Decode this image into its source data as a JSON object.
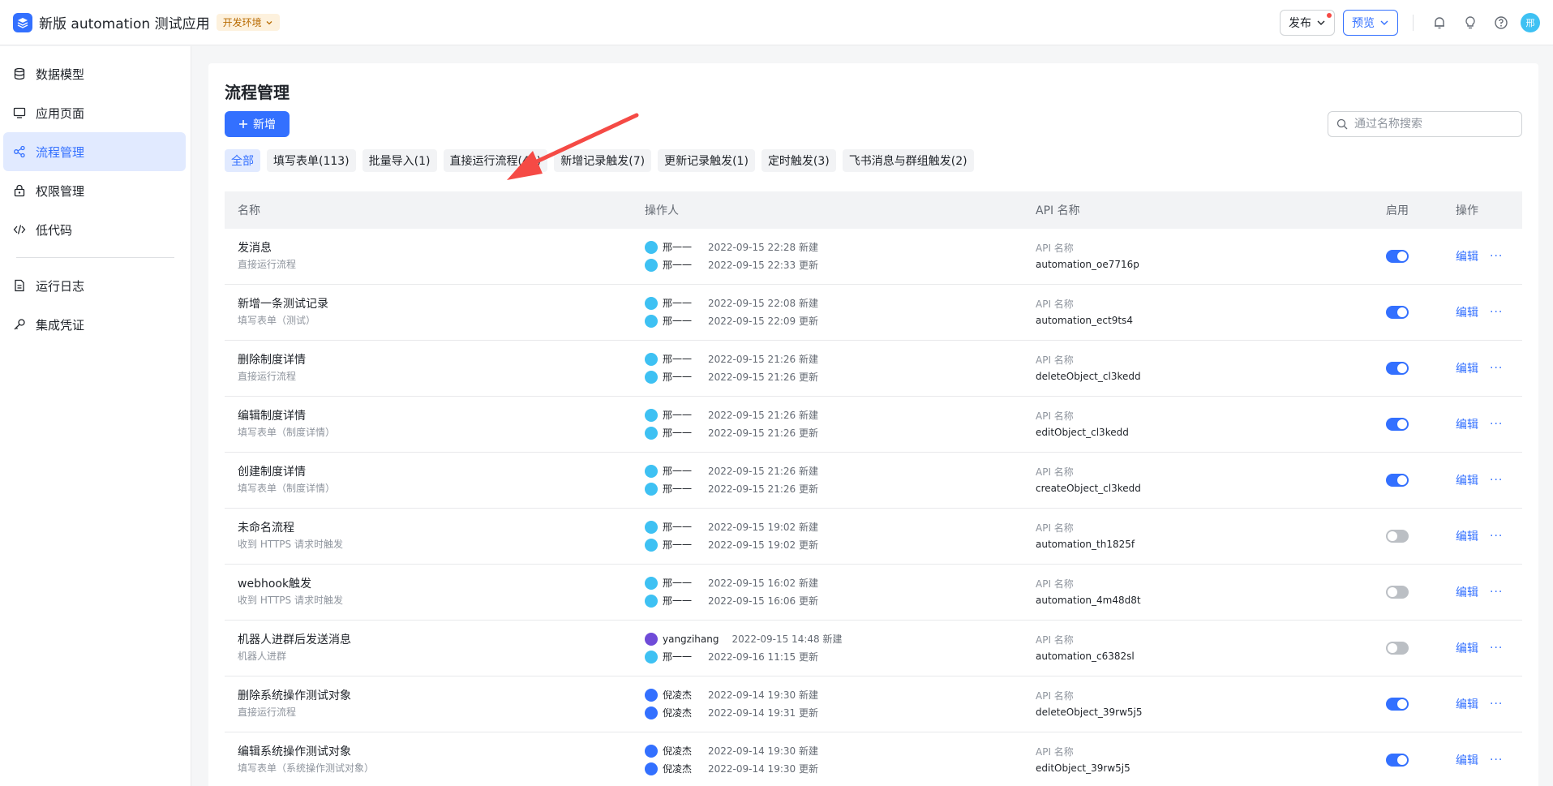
{
  "header": {
    "app_title": "新版 automation 测试应用",
    "env_badge": "开发环境",
    "publish_label": "发布",
    "preview_label": "预览",
    "avatar_text": "邢"
  },
  "sidebar": {
    "items": [
      {
        "label": "数据模型",
        "icon": "database-icon"
      },
      {
        "label": "应用页面",
        "icon": "monitor-icon"
      },
      {
        "label": "流程管理",
        "icon": "flow-icon"
      },
      {
        "label": "权限管理",
        "icon": "lock-icon"
      },
      {
        "label": "低代码",
        "icon": "code-icon"
      },
      {
        "label": "运行日志",
        "icon": "log-icon"
      },
      {
        "label": "集成凭证",
        "icon": "key-icon"
      }
    ]
  },
  "page": {
    "title": "流程管理",
    "add_label": "新增",
    "search_placeholder": "通过名称搜索"
  },
  "filters": [
    "全部",
    "填写表单(113)",
    "批量导入(1)",
    "直接运行流程(41)",
    "新增记录触发(7)",
    "更新记录触发(1)",
    "定时触发(3)",
    "飞书消息与群组触发(2)"
  ],
  "table": {
    "headers": [
      "名称",
      "操作人",
      "API 名称",
      "启用",
      "操作"
    ],
    "api_label": "API 名称",
    "edit_label": "编辑",
    "more_label": "···",
    "rows": [
      {
        "name": "发消息",
        "sub": "直接运行流程",
        "u1": "邢一一",
        "t1": "2022-09-15 22:28 新建",
        "u2": "邢一一",
        "t2": "2022-09-15 22:33 更新",
        "api": "automation_oe7716p",
        "enabled": true
      },
      {
        "name": "新增一条测试记录",
        "sub": "填写表单（测试）",
        "u1": "邢一一",
        "t1": "2022-09-15 22:08 新建",
        "u2": "邢一一",
        "t2": "2022-09-15 22:09 更新",
        "api": "automation_ect9ts4",
        "enabled": true
      },
      {
        "name": "删除制度详情",
        "sub": "直接运行流程",
        "u1": "邢一一",
        "t1": "2022-09-15 21:26 新建",
        "u2": "邢一一",
        "t2": "2022-09-15 21:26 更新",
        "api": "deleteObject_cl3kedd",
        "enabled": true
      },
      {
        "name": "编辑制度详情",
        "sub": "填写表单（制度详情）",
        "u1": "邢一一",
        "t1": "2022-09-15 21:26 新建",
        "u2": "邢一一",
        "t2": "2022-09-15 21:26 更新",
        "api": "editObject_cl3kedd",
        "enabled": true
      },
      {
        "name": "创建制度详情",
        "sub": "填写表单（制度详情）",
        "u1": "邢一一",
        "t1": "2022-09-15 21:26 新建",
        "u2": "邢一一",
        "t2": "2022-09-15 21:26 更新",
        "api": "createObject_cl3kedd",
        "enabled": true
      },
      {
        "name": "未命名流程",
        "sub": "收到 HTTPS 请求时触发",
        "u1": "邢一一",
        "t1": "2022-09-15 19:02 新建",
        "u2": "邢一一",
        "t2": "2022-09-15 19:02 更新",
        "api": "automation_th1825f",
        "enabled": false
      },
      {
        "name": "webhook触发",
        "sub": "收到 HTTPS 请求时触发",
        "u1": "邢一一",
        "t1": "2022-09-15 16:02 新建",
        "u2": "邢一一",
        "t2": "2022-09-15 16:06 更新",
        "api": "automation_4m48d8t",
        "enabled": false
      },
      {
        "name": "机器人进群后发送消息",
        "sub": "机器人进群",
        "u1": "yangzihang",
        "t1": "2022-09-15 14:48 新建",
        "u2": "邢一一",
        "t2": "2022-09-16 11:15 更新",
        "api": "automation_c6382sl",
        "enabled": false
      },
      {
        "name": "删除系统操作测试对象",
        "sub": "直接运行流程",
        "u1": "倪凌杰",
        "t1": "2022-09-14 19:30 新建",
        "u2": "倪凌杰",
        "t2": "2022-09-14 19:31 更新",
        "api": "deleteObject_39rw5j5",
        "enabled": true
      },
      {
        "name": "编辑系统操作测试对象",
        "sub": "填写表单（系统操作测试对象）",
        "u1": "倪凌杰",
        "t1": "2022-09-14 19:30 新建",
        "u2": "倪凌杰",
        "t2": "2022-09-14 19:30 更新",
        "api": "editObject_39rw5j5",
        "enabled": true
      }
    ]
  },
  "colors": {
    "accent": "#3370ff",
    "annotation_arrow": "#f54a45"
  }
}
